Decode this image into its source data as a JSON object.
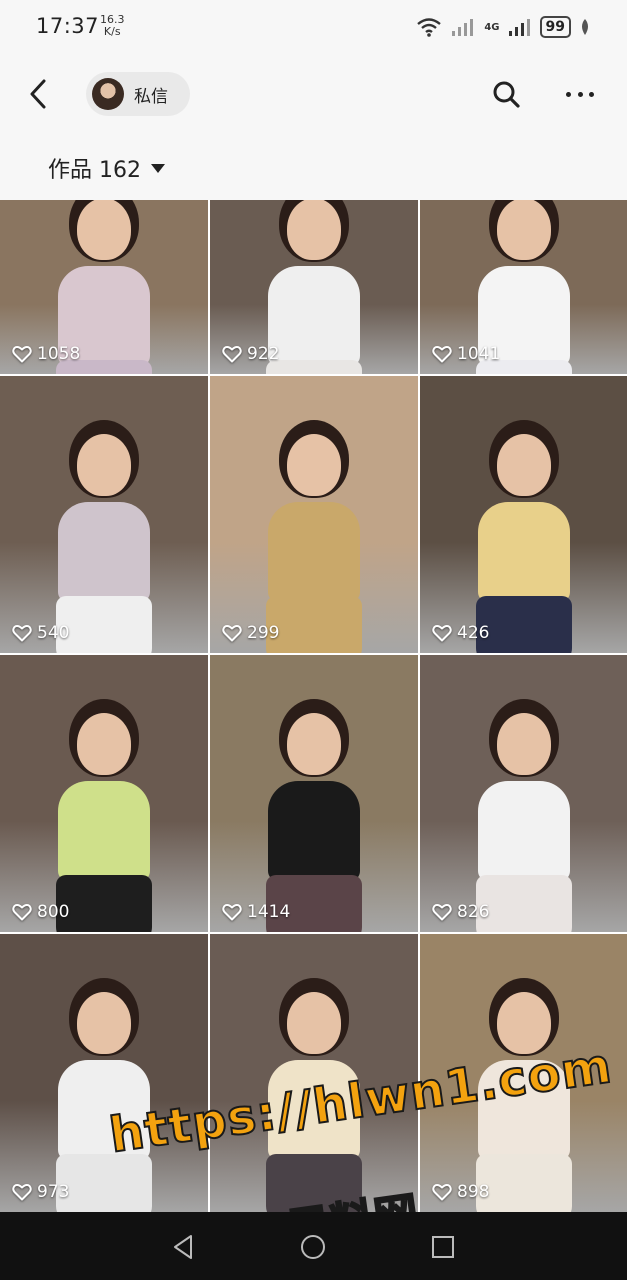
{
  "status_bar": {
    "time": "17:37",
    "net_speed_value": "16.3",
    "net_speed_unit": "K/s",
    "network_label": "4G",
    "battery": "99"
  },
  "header": {
    "dm_label": "私信",
    "works_tab": "作品 162"
  },
  "grid": {
    "tiles": [
      {
        "likes": "1058",
        "bg": "#8a7560",
        "top_color": "#d9c7cf",
        "bottom_color": "#c9b8c8"
      },
      {
        "likes": "922",
        "bg": "#6a5c52",
        "top_color": "#efefef",
        "bottom_color": "#e8e6e4"
      },
      {
        "likes": "1041",
        "bg": "#7d6a58",
        "top_color": "#f4f4f4",
        "bottom_color": "#ececf0"
      },
      {
        "likes": "540",
        "bg": "#6e5e52",
        "top_color": "#cfc4cc",
        "bottom_color": "#efefef"
      },
      {
        "likes": "299",
        "bg": "#c0a488",
        "top_color": "#c9a86a",
        "bottom_color": "#c9a86a"
      },
      {
        "likes": "426",
        "bg": "#5c4f44",
        "top_color": "#e8d08a",
        "bottom_color": "#2a2f4a"
      },
      {
        "likes": "800",
        "bg": "#6a5a50",
        "top_color": "#cfe08a",
        "bottom_color": "#1e1e1e"
      },
      {
        "likes": "1414",
        "bg": "#8a7a62",
        "top_color": "#1a1a1a",
        "bottom_color": "#5a4448"
      },
      {
        "likes": "826",
        "bg": "#6e6058",
        "top_color": "#f2f2f2",
        "bottom_color": "#e9e4e2"
      },
      {
        "likes": "973",
        "bg": "#5e5048",
        "top_color": "#efefef",
        "bottom_color": "#e6e6e6"
      },
      {
        "likes": "",
        "bg": "#6a5c54",
        "top_color": "#efe3c8",
        "bottom_color": "#4a4248"
      },
      {
        "likes": "898",
        "bg": "#9a8466",
        "top_color": "#efe6dc",
        "bottom_color": "#ece6dc"
      }
    ]
  },
  "watermark": {
    "url": "https://hlwn1.com",
    "name": "黑料网"
  },
  "icons": {
    "back": "chevron-left-icon",
    "search": "search-icon",
    "more": "more-horizontal-icon",
    "heart": "heart-outline-icon",
    "nav_back": "triangle-back-icon",
    "nav_home": "circle-home-icon",
    "nav_recents": "square-recents-icon"
  },
  "colors": {
    "header_bg": "#f7f7f7",
    "pill_bg": "#e9e9e9",
    "watermark": "#f3a20f",
    "navbar_bg": "#111111"
  }
}
